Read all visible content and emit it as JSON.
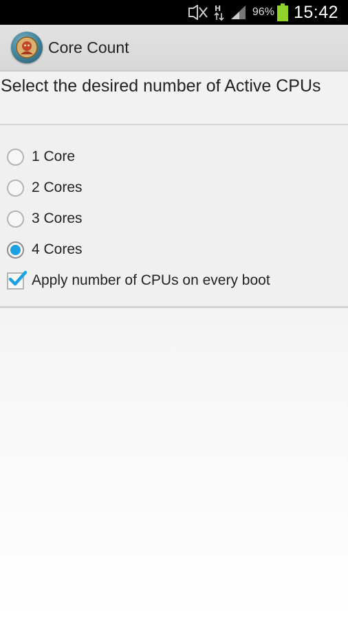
{
  "status_bar": {
    "icons": [
      "mute-icon",
      "data-transfer-icon",
      "signal-icon",
      "battery-icon"
    ],
    "battery": "96%",
    "time": "15:42"
  },
  "app_bar": {
    "icon": "app-logo-icon",
    "title": "Core Count"
  },
  "header": {
    "prompt": "Select the desired number of Active CPUs"
  },
  "options": {
    "items": [
      {
        "label": "1 Core",
        "checked": false
      },
      {
        "label": "2 Cores",
        "checked": false
      },
      {
        "label": "3 Cores",
        "checked": false
      },
      {
        "label": "4 Cores",
        "checked": true
      }
    ],
    "apply_on_boot": {
      "label": "Apply number of CPUs on every boot",
      "checked": true
    }
  },
  "colors": {
    "accent": "#1ba1e2",
    "status_bar_bg": "#000000",
    "battery": "#8fd32a"
  }
}
